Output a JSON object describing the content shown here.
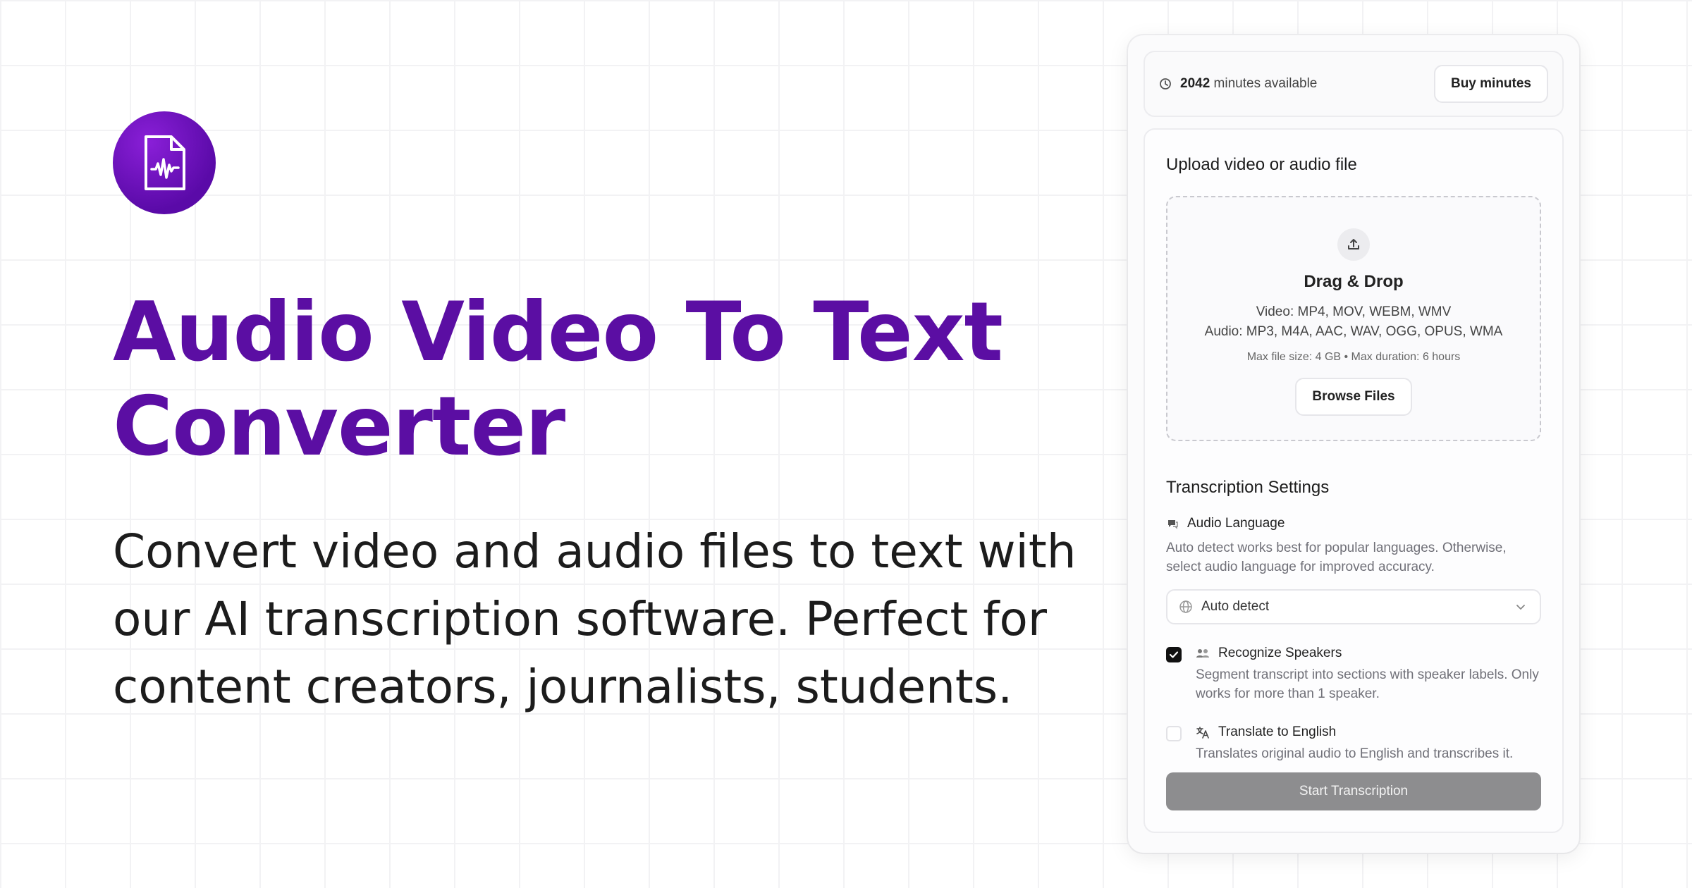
{
  "hero": {
    "title_line1": "Audio Video To Text",
    "title_line2": "Converter",
    "description": "Convert video and audio files to text with our AI transcription software. Perfect for content creators, journalists, students."
  },
  "topbar": {
    "minutes_count": "2042",
    "minutes_suffix": " minutes available",
    "buy_label": "Buy minutes"
  },
  "upload": {
    "title": "Upload video or audio file",
    "dropzone_title": "Drag & Drop",
    "video_formats": "Video: MP4, MOV, WEBM, WMV",
    "audio_formats": "Audio: MP3, M4A, AAC, WAV, OGG, OPUS, WMA",
    "limits": "Max file size: 4 GB • Max duration: 6 hours",
    "browse_label": "Browse Files"
  },
  "settings": {
    "title": "Transcription Settings",
    "language_label": "Audio Language",
    "language_help": "Auto detect works best for popular languages. Otherwise, select audio language for improved accuracy.",
    "language_value": "Auto detect",
    "speakers_label": "Recognize Speakers",
    "speakers_help": "Segment transcript into sections with speaker labels. Only works for more than 1 speaker.",
    "speakers_checked": true,
    "translate_label": "Translate to English",
    "translate_help": "Translates original audio to English and transcribes it.",
    "translate_checked": false
  },
  "start_label": "Start Transcription",
  "colors": {
    "brand": "#5b0ea3",
    "logo_bg": "#7a16c9",
    "start_button": "#8d8d8f"
  },
  "icons": {
    "logo": "audio-file-waveform-icon",
    "minutes": "clock-icon",
    "upload": "upload-icon",
    "language": "speech-bubble-icon",
    "select_prefix": "globe-icon",
    "select_suffix": "chevron-down-icon",
    "speakers": "users-icon",
    "translate": "translate-icon"
  }
}
